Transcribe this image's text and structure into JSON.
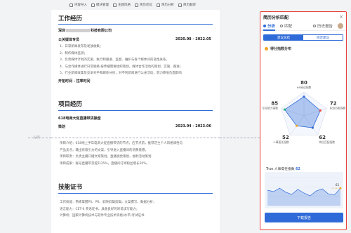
{
  "toolbar": {
    "items": [
      {
        "icon": "import-icon",
        "label": "内容导入"
      },
      {
        "icon": "template-icon",
        "label": "模块管理"
      },
      {
        "icon": "theme-icon",
        "label": "主题风格"
      },
      {
        "icon": "diagnose-icon",
        "label": "简历优化"
      },
      {
        "icon": "analysis-icon",
        "label": "简历分析"
      },
      {
        "icon": "translate-icon",
        "label": "简历翻译"
      }
    ]
  },
  "resume": {
    "work": {
      "title": "工作经历",
      "company": "深圳科技有限公司",
      "company_prefix": "深圳",
      "company_suffix": "科技有限公司",
      "role": "公关媒体专员",
      "dates": "2020.08 - 2022.05",
      "bullets": [
        "1、日常新闻发布及发放收集；",
        "2、制作媒体监测；",
        "3、负责媒体计划的实施、执行和跟进、监督、维护与各个媒体间的良性关系。",
        "4、与合作媒体进行日常联络 按传播需要组织策划，媒体合作活动的策划、实施、跟进；",
        "5、行业新闻收集及竞争对手和媒体分析，对不利新闻进行公关活动，努力降低负面影响"
      ],
      "footer": "开拓时间 - 拉率时间"
    },
    "project": {
      "title": "项目经历",
      "name": "618电商大促直播带货操盘",
      "role": "策划",
      "dates": "2023.04 - 2023.06",
      "bullets": [
        "项目介绍：618线上手年电商大促直播带货的节点，应节点前，推荐店主个人风格调性与",
        "产品卖点，输出有吸引力的文案，引导进入直播间的消费意愿。",
        "项目职责：负责主播口播文案策划，直播视觉策划，福利活动策划",
        "项目成果：账号直播带货提升35%，直播间订阅粉丝增长20%。"
      ]
    },
    "skills": {
      "title": "技能证书",
      "bullets": [
        "工作技能：熟练掌握PS、PR、剪映剪辑剪辑，文案撰写、数据分析；",
        "语言能力：CET-6 英语证书，具备良好的听说读写能力；",
        "计算机：国家计算机技术与软件专业技术资格(水平)考试证书"
      ]
    },
    "page_label": "分页"
  },
  "panel": {
    "title": "简历分析匹配",
    "close": "×",
    "tabs": [
      "分析",
      "匹配",
      "历史报告"
    ],
    "segments": [
      "建议总结",
      "修改建议"
    ],
    "score_label": "得分指数分布",
    "trend_label": "True 人事得任指数",
    "trend_value": "62",
    "button": "下载报告",
    "accent": "#2f6bd8",
    "border": "#e8453c"
  },
  "chart_data": [
    {
      "type": "radar",
      "categories": [
        "HR阅读指数",
        "职业匹配指数",
        "人事面任指数",
        "岗位匹配指数",
        "专业能力指数"
      ],
      "values": [
        80,
        72,
        52,
        62,
        85
      ],
      "value_labels": [
        "80",
        "72",
        "52",
        "62",
        "85"
      ],
      "title": "",
      "max": 100
    },
    {
      "type": "area",
      "series": [
        {
          "values": [
            55,
            50,
            62,
            48,
            40,
            58,
            45,
            35,
            52,
            60,
            42,
            38,
            62
          ]
        }
      ],
      "marker_label": "62",
      "ylim": [
        0,
        100
      ]
    }
  ]
}
